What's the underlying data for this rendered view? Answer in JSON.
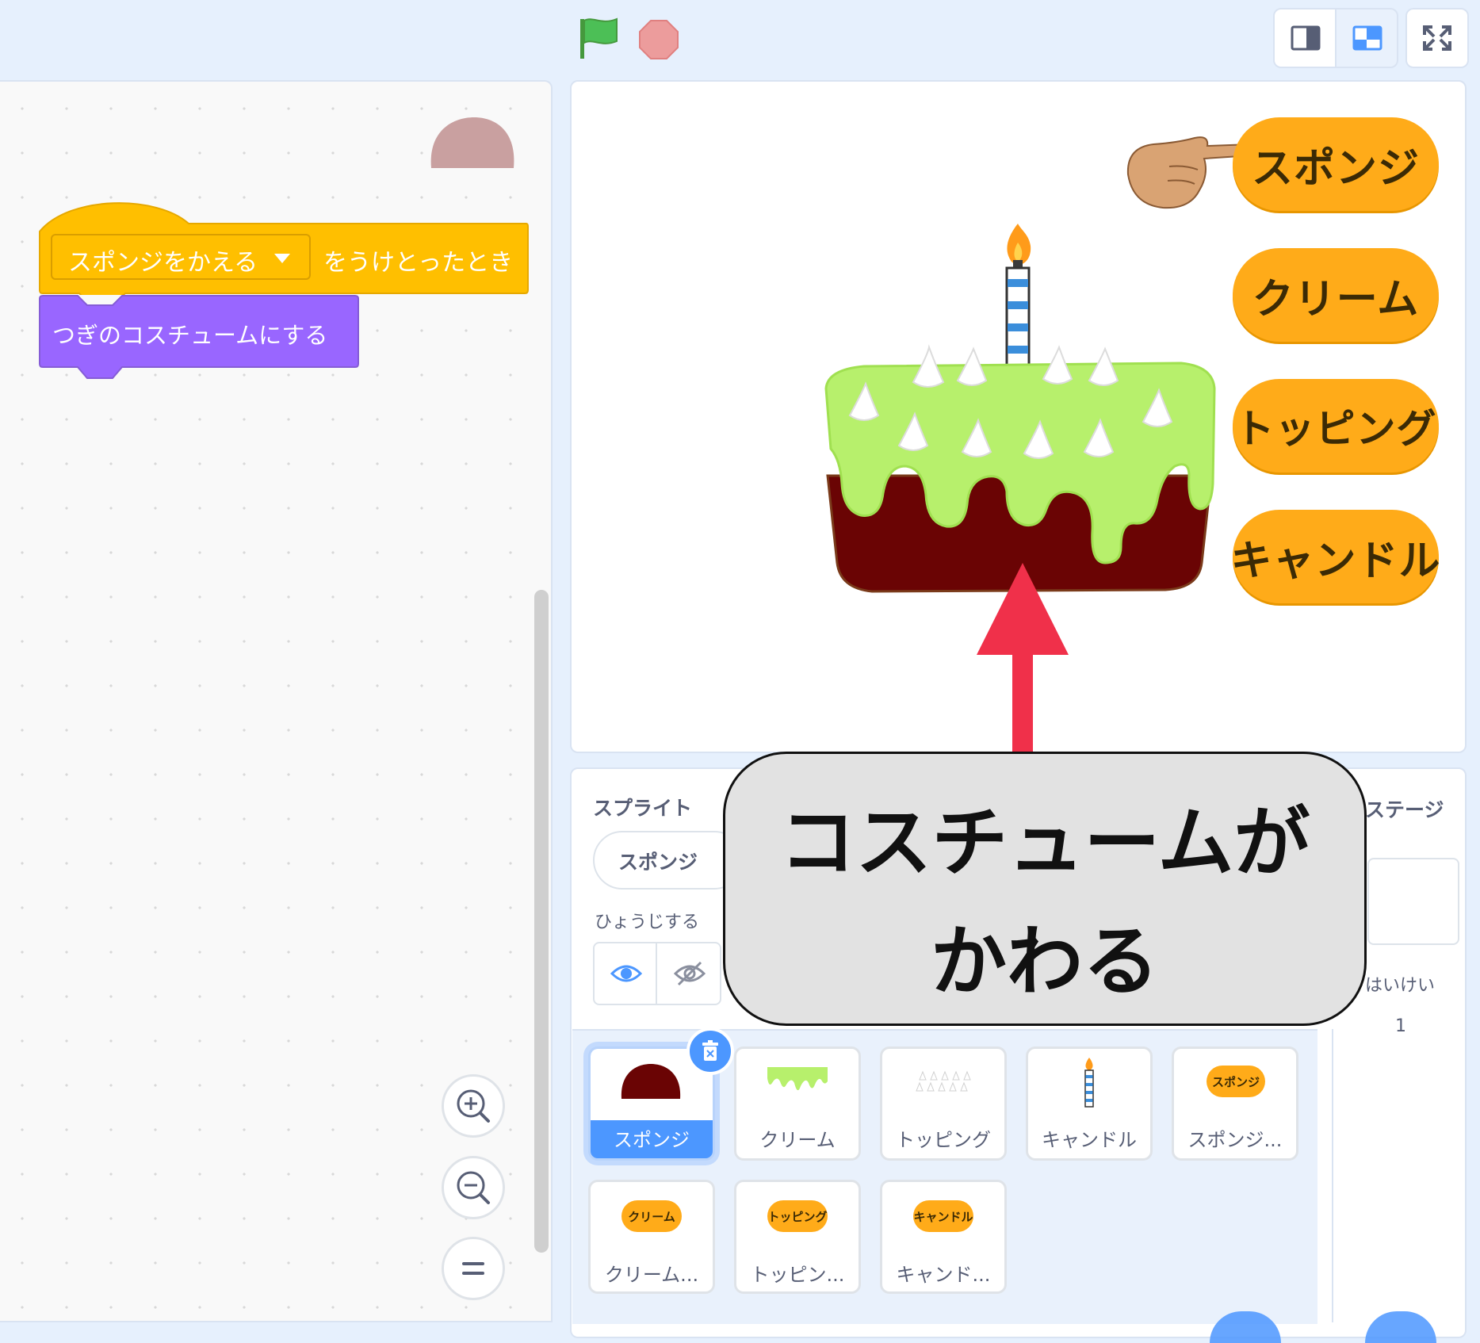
{
  "code_area": {
    "hat_block": {
      "dropdown": "スポンジをかえる",
      "suffix": "をうけとったとき"
    },
    "looks_block": {
      "label": "つぎのコスチュームにする"
    },
    "zoom": {
      "in": "zoom-in",
      "out": "zoom-out",
      "reset": "="
    }
  },
  "stage": {
    "buttons": [
      "スポンジ",
      "クリーム",
      "トッピング",
      "キャンドル"
    ]
  },
  "sprite_info": {
    "title": "スプライト",
    "name": "スポンジ",
    "show_label": "ひょうじする"
  },
  "stage_pane": {
    "title": "ステージ",
    "backdrop_label": "はいけい",
    "backdrop_count": "1"
  },
  "sprites": [
    {
      "label": "スポンジ",
      "selected": true
    },
    {
      "label": "クリーム"
    },
    {
      "label": "トッピング"
    },
    {
      "label": "キャンドル"
    },
    {
      "label": "スポンジ...",
      "thumb_text": "スポンジ"
    },
    {
      "label": "クリーム...",
      "thumb_text": "クリーム"
    },
    {
      "label": "トッピン...",
      "thumb_text": "トッピング"
    },
    {
      "label": "キャンド...",
      "thumb_text": "キャンドル"
    }
  ],
  "callout": {
    "line1": "コスチュームが",
    "line2": "かわる"
  },
  "colors": {
    "events_block": "#ffbf00",
    "looks_block": "#9966ff",
    "stage_button": "#ffab19",
    "accent": "#4c97ff",
    "sponge": "#6a0404",
    "cream": "#b7f06c",
    "arrow": "#f0304a"
  }
}
